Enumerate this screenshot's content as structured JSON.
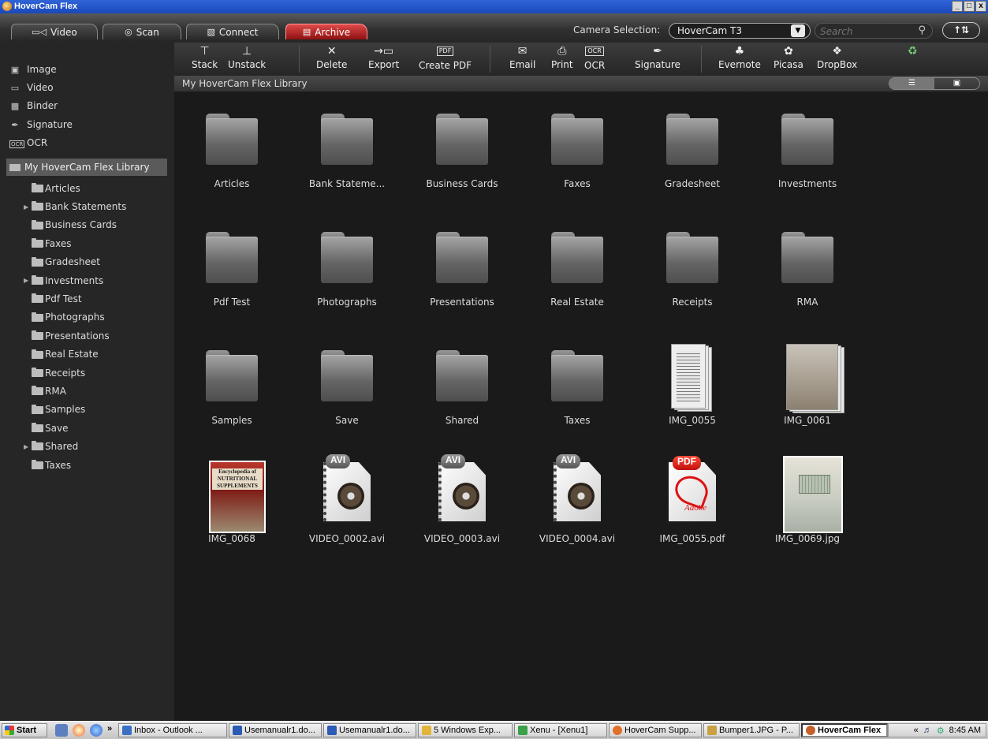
{
  "window": {
    "title": "HoverCam Flex",
    "min": "_",
    "max": "□",
    "close": "x"
  },
  "tabs": [
    {
      "label": "Video",
      "icon": "video-camera-icon"
    },
    {
      "label": "Scan",
      "icon": "scan-target-icon"
    },
    {
      "label": "Connect",
      "icon": "connect-icon"
    },
    {
      "label": "Archive",
      "icon": "archive-icon",
      "active": true
    }
  ],
  "camera": {
    "label": "Camera Selection:",
    "selected": "HoverCam T3"
  },
  "search": {
    "placeholder": "Search"
  },
  "sidebar": {
    "types": [
      {
        "label": "Image",
        "icon": "image-icon"
      },
      {
        "label": "Video",
        "icon": "video-icon"
      },
      {
        "label": "Binder",
        "icon": "binder-icon"
      },
      {
        "label": "Signature",
        "icon": "signature-pen-icon"
      },
      {
        "label": "OCR",
        "icon": "ocr-icon",
        "badge": "OCR"
      }
    ],
    "library_root": "My HoverCam Flex Library",
    "folders": [
      {
        "label": "Articles",
        "expandable": false
      },
      {
        "label": "Bank Statements",
        "expandable": true
      },
      {
        "label": "Business Cards",
        "expandable": false
      },
      {
        "label": "Faxes",
        "expandable": false
      },
      {
        "label": "Gradesheet",
        "expandable": false
      },
      {
        "label": "Investments",
        "expandable": true
      },
      {
        "label": "Pdf Test",
        "expandable": false
      },
      {
        "label": "Photographs",
        "expandable": false
      },
      {
        "label": "Presentations",
        "expandable": false
      },
      {
        "label": "Real Estate",
        "expandable": false
      },
      {
        "label": "Receipts",
        "expandable": false
      },
      {
        "label": "RMA",
        "expandable": false
      },
      {
        "label": "Samples",
        "expandable": false
      },
      {
        "label": "Save",
        "expandable": false
      },
      {
        "label": "Shared",
        "expandable": true
      },
      {
        "label": "Taxes",
        "expandable": false
      }
    ]
  },
  "toolbar": {
    "stack": "Stack",
    "unstack": "Unstack",
    "delete": "Delete",
    "export": "Export",
    "create_pdf": "Create PDF",
    "pdf_icon_text": "PDF",
    "email": "Email",
    "print": "Print",
    "ocr": "OCR",
    "ocr_icon_text": "OCR",
    "signature": "Signature",
    "evernote": "Evernote",
    "picasa": "Picasa",
    "dropbox": "DropBox"
  },
  "path": "My HoverCam Flex Library",
  "items": [
    {
      "label": "Articles",
      "kind": "folder"
    },
    {
      "label": "Bank Stateme...",
      "kind": "folder"
    },
    {
      "label": "Business Cards",
      "kind": "folder"
    },
    {
      "label": "Faxes",
      "kind": "folder"
    },
    {
      "label": "Gradesheet",
      "kind": "folder"
    },
    {
      "label": "Investments",
      "kind": "folder"
    },
    {
      "label": "Pdf Test",
      "kind": "folder"
    },
    {
      "label": "Photographs",
      "kind": "folder"
    },
    {
      "label": "Presentations",
      "kind": "folder"
    },
    {
      "label": "Real Estate",
      "kind": "folder"
    },
    {
      "label": "Receipts",
      "kind": "folder"
    },
    {
      "label": "RMA",
      "kind": "folder"
    },
    {
      "label": "Samples",
      "kind": "folder"
    },
    {
      "label": "Save",
      "kind": "folder"
    },
    {
      "label": "Shared",
      "kind": "folder"
    },
    {
      "label": "Taxes",
      "kind": "folder"
    },
    {
      "label": "IMG_0055",
      "kind": "doc-stack"
    },
    {
      "label": "IMG_0061",
      "kind": "photo-stack"
    },
    {
      "label": "IMG_0068",
      "kind": "book",
      "thumb_text": [
        "Encyclopedia of",
        "NUTRITIONAL",
        "SUPPLEMENTS"
      ]
    },
    {
      "label": "VIDEO_0002.avi",
      "kind": "avi",
      "badge": "AVI"
    },
    {
      "label": "VIDEO_0003.avi",
      "kind": "avi",
      "badge": "AVI"
    },
    {
      "label": "VIDEO_0004.avi",
      "kind": "avi",
      "badge": "AVI"
    },
    {
      "label": "IMG_0055.pdf",
      "kind": "pdf",
      "badge": "PDF",
      "brand": "Adobe"
    },
    {
      "label": "IMG_0069.jpg",
      "kind": "jpg"
    }
  ],
  "taskbar": {
    "start": "Start",
    "more": "»",
    "tasks": [
      {
        "label": "Inbox - Outlook ...",
        "color": "#3a6fc4"
      },
      {
        "label": "Usemanualr1.do...",
        "color": "#2b5bb5"
      },
      {
        "label": "Usemanualr1.do...",
        "color": "#2b5bb5"
      },
      {
        "label": "5 Windows Exp...",
        "color": "#e3b43a"
      },
      {
        "label": "Xenu - [Xenu1]",
        "color": "#3aa04a"
      },
      {
        "label": "HoverCam Supp...",
        "color": "#e0702a"
      },
      {
        "label": "Bumper1.JPG - P...",
        "color": "#caa040"
      },
      {
        "label": "HoverCam Flex",
        "color": "#c4602a",
        "active": true
      }
    ],
    "tray_more": "«",
    "clock": "8:45 AM"
  }
}
